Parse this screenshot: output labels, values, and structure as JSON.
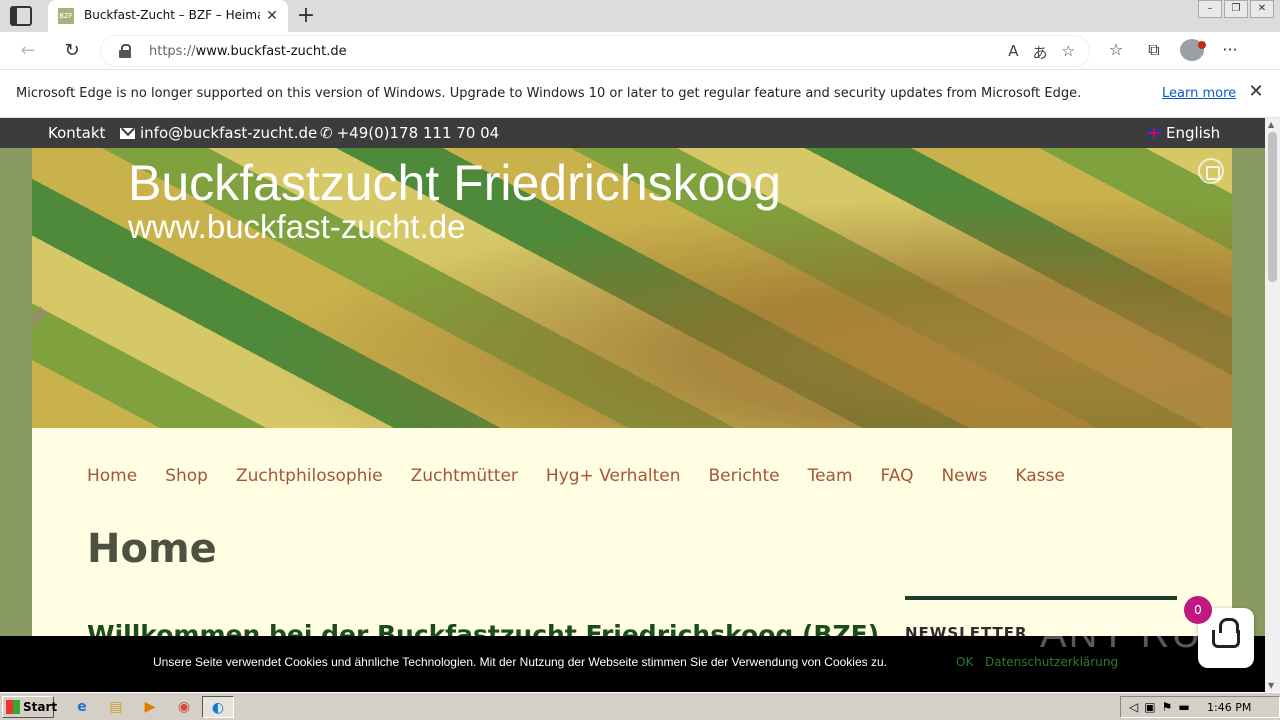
{
  "browser": {
    "tab": {
      "favicon_text": "BZF",
      "title": "Buckfast-Zucht – BZF – Heimat h",
      "close": "✕"
    },
    "new_tab": "+",
    "window_controls": [
      "–",
      "❐",
      "✕"
    ],
    "nav": {
      "back": "←",
      "reload": "↻"
    },
    "url": {
      "prefix": "https://",
      "host": "www.buckfast-zucht.de"
    },
    "url_icons": [
      "read-aloud-icon",
      "translate-icon",
      "add-favorite-icon"
    ],
    "url_icon_glyphs": [
      "A",
      "あ",
      "☆"
    ],
    "toolbar_glyphs": [
      "☆",
      "⧉"
    ],
    "more": "···"
  },
  "infobar": {
    "message": "Microsoft Edge is no longer supported on this version of Windows. Upgrade to Windows 10 or later to get regular feature and security updates from Microsoft Edge.",
    "link": "Learn more",
    "close": "✕"
  },
  "site": {
    "topbar": {
      "contact": "Kontakt",
      "email": "info@buckfast-zucht.de",
      "phone_glyph": "✆",
      "phone": "+49(0)178 111 70 04",
      "language": "English"
    },
    "hero": {
      "title": "Buckfastzucht Friedrichskoog",
      "subtitle": "www.buckfast-zucht.de"
    },
    "menu": [
      "Home",
      "Shop",
      "Zuchtphilosophie",
      "Zuchtmütter",
      "Hyg+ Verhalten",
      "Berichte",
      "Team",
      "FAQ",
      "News",
      "Kasse"
    ],
    "page_title": "Home",
    "welcome": "Willkommen bei der Buckfastzucht Friedrichskoog (BZF)",
    "sidebar_title": "NEWSLETTER",
    "cookie": {
      "text": "Unsere Seite verwendet Cookies und ähnliche Technologien. Mit der Nutzung der Webseite stimmen Sie der Verwendung von Cookies zu.",
      "ok": "OK",
      "link": "Datenschutzerklärung"
    },
    "cart_count": "0",
    "watermark": "ANY RUN"
  },
  "taskbar": {
    "start": "Start",
    "apps": [
      "ie-icon",
      "folder-icon",
      "media-icon",
      "chrome-icon",
      "edge-icon"
    ],
    "app_glyphs": [
      "e",
      "▤",
      "▶",
      "◉",
      "◐"
    ],
    "tray_glyphs": [
      "◁",
      "▣",
      "⚑",
      "▬"
    ],
    "clock": "1:46 PM"
  },
  "colors": {
    "topbar_bg": "#3c3c3c",
    "page_bg": "#8a9b61",
    "content_bg": "#fffde2",
    "menu_text": "#a4553a",
    "cart_badge": "#c0187e"
  }
}
